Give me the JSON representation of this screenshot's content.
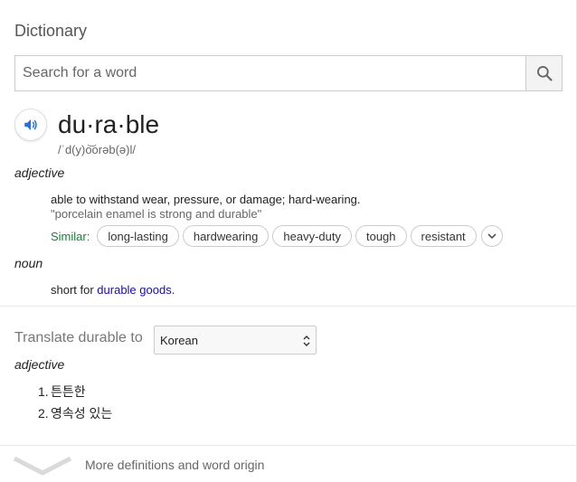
{
  "dictionary": {
    "title": "Dictionary",
    "search": {
      "placeholder": "Search for a word",
      "value": ""
    },
    "entry": {
      "word": "du·ra·ble",
      "phonetic": "/ˈd(y)o͝orəb(ə)l/",
      "adjective": {
        "pos": "adjective",
        "definition": "able to withstand wear, pressure, or damage; hard-wearing.",
        "example": "\"porcelain enamel is strong and durable\"",
        "similar_label": "Similar:",
        "similar": [
          "long-lasting",
          "hardwearing",
          "heavy-duty",
          "tough",
          "resistant"
        ]
      },
      "noun": {
        "pos": "noun",
        "definition_prefix": "short for ",
        "definition_link": "durable goods",
        "definition_suffix": "."
      }
    },
    "translate": {
      "label": "Translate durable to",
      "language": "Korean",
      "pos": "adjective",
      "items": [
        {
          "num": "1.",
          "text": "튼튼한"
        },
        {
          "num": "2.",
          "text": "영속성 있는"
        }
      ]
    },
    "more": {
      "label": "More definitions and word origin"
    }
  },
  "colors": {
    "similar_label": "#188038",
    "link": "#1a0dab",
    "audio_icon": "#1a73e8"
  },
  "icons": {
    "search": "search-icon",
    "audio": "speaker-icon",
    "more": "chevron-down-icon"
  }
}
